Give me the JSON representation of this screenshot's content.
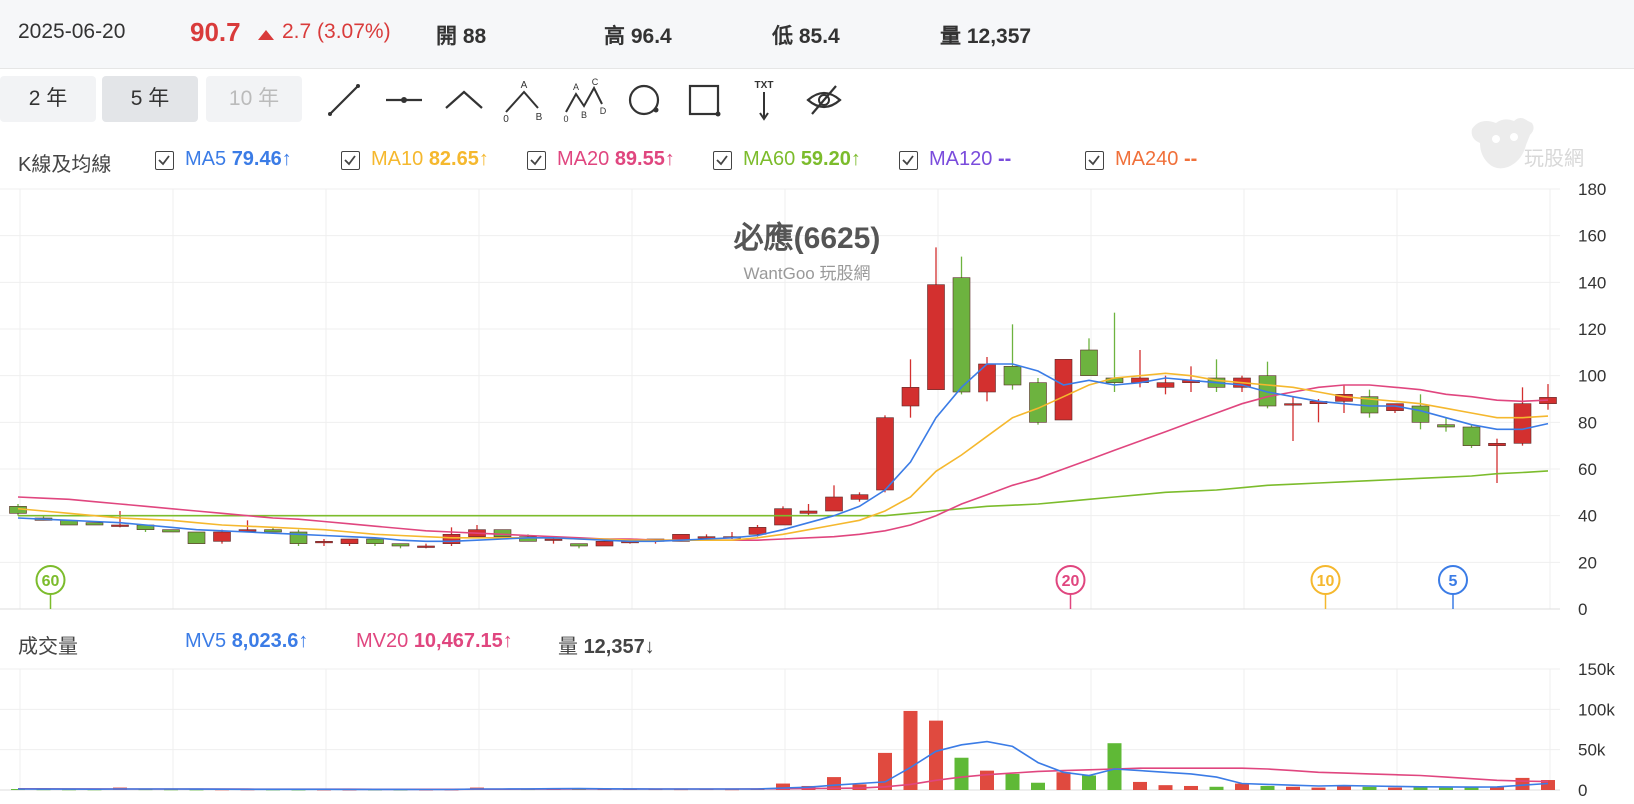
{
  "header": {
    "date": "2025-06-20",
    "price": "90.7",
    "change": "2.7 (3.07%)",
    "open": "開 88",
    "high": "高 96.4",
    "low": "低 85.4",
    "volume": "量 12,357"
  },
  "periods": [
    {
      "label": "2 年",
      "state": "normal"
    },
    {
      "label": "5 年",
      "state": "active"
    },
    {
      "label": "10 年",
      "state": "disabled"
    }
  ],
  "tools": [
    "line-icon",
    "horizontal-line-icon",
    "angle-line-icon",
    "abc-pattern-icon",
    "abcd-pattern-icon",
    "circle-icon",
    "rectangle-icon",
    "text-arrow-icon",
    "hide-eye-icon"
  ],
  "tool_labels": {
    "abc_a": "A",
    "abc_b": "B",
    "abc_o": "0",
    "abcd_a": "A",
    "abcd_b": "B",
    "abcd_c": "C",
    "abcd_d": "D",
    "abcd_o": "0",
    "txt": "TXT"
  },
  "kline_legend": {
    "title": "K線及均線",
    "items": [
      {
        "name": "MA5",
        "value": "79.46",
        "arrow": "↑",
        "color": "#3b7ce6"
      },
      {
        "name": "MA10",
        "value": "82.65",
        "arrow": "↑",
        "color": "#f5b82e"
      },
      {
        "name": "MA20",
        "value": "89.55",
        "arrow": "↑",
        "color": "#e0467f"
      },
      {
        "name": "MA60",
        "value": "59.20",
        "arrow": "↑",
        "color": "#7cbc2c"
      },
      {
        "name": "MA120",
        "value": "--",
        "arrow": "",
        "color": "#7a4cdc"
      },
      {
        "name": "MA240",
        "value": "--",
        "arrow": "",
        "color": "#f0703a"
      }
    ]
  },
  "volume_legend": {
    "title": "成交量",
    "items": [
      {
        "name": "MV5",
        "value": "8,023.6",
        "arrow": "↑",
        "color": "#3b7ce6"
      },
      {
        "name": "MV20",
        "value": "10,467.15",
        "arrow": "↑",
        "color": "#e0467f"
      },
      {
        "name": "量",
        "value": "12,357",
        "arrow": "↓",
        "color": "#444"
      }
    ]
  },
  "watermark": {
    "title": "必應(6625)",
    "subtitle": "WantGoo 玩股網",
    "logo_text": "玩股網"
  },
  "colors": {
    "up": "#d3302f",
    "down": "#6db33f",
    "ma5": "#3b7ce6",
    "ma10": "#f5b82e",
    "ma20": "#e0467f",
    "ma60": "#7cbc2c"
  },
  "chart_data": [
    {
      "type": "candlestick",
      "ylim": [
        0,
        180
      ],
      "yticks": [
        "0",
        "20",
        "40",
        "60",
        "80",
        "100",
        "120",
        "140",
        "160",
        "180"
      ],
      "ohlc": [
        [
          44,
          45,
          40,
          41
        ],
        [
          39,
          40,
          38,
          38
        ],
        [
          38,
          38,
          36,
          36
        ],
        [
          37,
          37,
          36,
          36
        ],
        [
          36,
          42,
          35,
          36
        ],
        [
          36,
          36,
          33,
          34
        ],
        [
          34,
          34,
          33,
          33
        ],
        [
          33,
          33,
          28,
          28
        ],
        [
          29,
          34,
          28,
          33
        ],
        [
          34,
          38,
          33,
          34
        ],
        [
          34,
          35,
          33,
          33
        ],
        [
          33,
          34,
          27,
          28
        ],
        [
          29,
          30,
          27,
          29
        ],
        [
          28,
          30,
          27,
          30
        ],
        [
          30,
          30,
          27,
          28
        ],
        [
          28,
          28,
          26,
          27
        ],
        [
          27,
          28,
          26,
          27
        ],
        [
          28,
          35,
          27,
          32
        ],
        [
          31,
          36,
          31,
          34
        ],
        [
          34,
          34,
          31,
          31
        ],
        [
          31,
          32,
          29,
          29
        ],
        [
          30,
          31,
          28,
          30
        ],
        [
          28,
          28,
          26,
          27
        ],
        [
          27,
          30,
          27,
          29
        ],
        [
          29,
          30,
          28,
          29
        ],
        [
          29,
          30,
          28,
          30
        ],
        [
          29,
          32,
          29,
          32
        ],
        [
          31,
          32,
          30,
          31
        ],
        [
          31,
          33,
          30,
          31
        ],
        [
          32,
          36,
          31,
          35
        ],
        [
          36,
          44,
          36,
          43
        ],
        [
          41,
          45,
          40,
          42
        ],
        [
          42,
          53,
          42,
          48
        ],
        [
          47,
          50,
          46,
          49
        ],
        [
          51,
          83,
          50,
          82
        ],
        [
          87,
          107,
          82,
          95
        ],
        [
          94,
          155,
          94,
          139
        ],
        [
          142,
          151,
          92,
          93
        ],
        [
          93,
          108,
          89,
          105
        ],
        [
          104,
          122,
          94,
          96
        ],
        [
          97,
          99,
          79,
          80
        ],
        [
          81,
          107,
          81,
          107
        ],
        [
          111,
          116,
          100,
          100
        ],
        [
          99,
          127,
          93,
          97
        ],
        [
          97,
          111,
          95,
          99
        ],
        [
          95,
          100,
          92,
          97
        ],
        [
          97,
          104,
          93,
          98
        ],
        [
          99,
          107,
          93,
          95
        ],
        [
          95,
          100,
          93,
          99
        ],
        [
          100,
          106,
          86,
          87
        ],
        [
          88,
          91,
          72,
          88
        ],
        [
          88,
          90,
          80,
          89
        ],
        [
          89,
          96,
          84,
          92
        ],
        [
          91,
          94,
          82,
          84
        ],
        [
          85,
          88,
          84,
          88
        ],
        [
          87,
          92,
          77,
          80
        ],
        [
          79,
          82,
          76,
          78
        ],
        [
          78,
          79,
          69,
          70
        ],
        [
          70,
          73,
          54,
          71
        ],
        [
          71,
          95,
          70,
          88
        ],
        [
          88,
          96.4,
          85.4,
          90.7
        ]
      ],
      "ma5": [
        39,
        38.5,
        38,
        37.5,
        37,
        36,
        35,
        34,
        33.5,
        33,
        32.5,
        32,
        31.5,
        31,
        30.5,
        29.5,
        29,
        29,
        29.5,
        30,
        30.5,
        30.5,
        30,
        29.5,
        29,
        29,
        29.5,
        30,
        30.5,
        31.5,
        34,
        37,
        40,
        44,
        51,
        63,
        82,
        95,
        105,
        105,
        102,
        96,
        98,
        96,
        97,
        99,
        98,
        97,
        96,
        93,
        91,
        89,
        88,
        87,
        87,
        85,
        82,
        79,
        77,
        77,
        79.46
      ],
      "ma10": [
        43,
        42,
        41,
        40,
        39,
        38.5,
        38,
        37,
        36,
        35.5,
        35,
        34.5,
        34,
        33,
        32,
        31.5,
        31,
        30.5,
        30.5,
        30.5,
        30.5,
        30.5,
        30,
        30,
        29.5,
        29.5,
        29.5,
        29.5,
        29.5,
        30.5,
        32,
        34,
        36,
        38,
        42,
        48,
        59,
        66,
        74,
        82,
        86,
        91,
        96,
        99,
        100,
        101,
        100,
        98,
        97,
        96,
        95,
        93,
        91,
        90,
        89,
        88,
        86,
        84,
        82,
        82,
        82.65
      ],
      "ma20": [
        48,
        47.5,
        47,
        46,
        45,
        44,
        43,
        42,
        41,
        40,
        39,
        38.5,
        37.5,
        36.5,
        35.5,
        34.5,
        33.5,
        33,
        32.5,
        32,
        31.5,
        31,
        30.5,
        30,
        30,
        29.5,
        29.5,
        29.5,
        29.5,
        29.5,
        30,
        30.5,
        31,
        32,
        33.5,
        36,
        40,
        45,
        49,
        53,
        56,
        60,
        64,
        68,
        72,
        76,
        80,
        84,
        88,
        91,
        93,
        95,
        96,
        96,
        95,
        94,
        92,
        91,
        89.5,
        89,
        89.55
      ],
      "ma60": [
        40,
        40,
        40,
        40,
        40,
        40,
        40,
        40,
        40,
        40,
        40,
        40,
        40,
        40,
        40,
        40,
        40,
        40,
        40,
        40,
        40,
        40,
        40,
        40,
        40,
        40,
        40,
        40,
        40,
        40,
        40,
        40,
        40,
        40,
        40,
        41,
        42,
        43,
        44,
        44.5,
        45,
        46,
        47,
        48,
        49,
        50,
        50.5,
        51,
        52,
        53,
        53.5,
        54,
        54.5,
        55,
        55.5,
        56,
        56.5,
        57,
        58,
        58.5,
        59.2
      ],
      "markers": [
        {
          "label": "60",
          "color": "#7cbc2c",
          "index": 1
        },
        {
          "label": "20",
          "color": "#e0467f",
          "index": 41
        },
        {
          "label": "10",
          "color": "#f5b82e",
          "index": 51
        },
        {
          "label": "5",
          "color": "#3b7ce6",
          "index": 56
        }
      ]
    },
    {
      "type": "bar",
      "ylim": [
        0,
        150000
      ],
      "yticks": [
        "0",
        "50k",
        "100k",
        "150k"
      ],
      "values": [
        1200,
        1000,
        900,
        900,
        3000,
        1100,
        900,
        800,
        900,
        900,
        800,
        700,
        700,
        600,
        700,
        600,
        600,
        700,
        3000,
        1500,
        1200,
        1800,
        1500,
        1200,
        1300,
        1200,
        1100,
        1200,
        1000,
        1800,
        8000,
        5000,
        16000,
        7000,
        46000,
        98000,
        86000,
        40000,
        24000,
        20000,
        9000,
        22000,
        18000,
        58000,
        10000,
        6000,
        5000,
        4000,
        8000,
        5000,
        4000,
        3000,
        6000,
        4000,
        3000,
        4000,
        3000,
        4000,
        4000,
        15000,
        12357
      ],
      "mv5": [
        1200,
        1150,
        1100,
        1050,
        1200,
        1300,
        1200,
        1100,
        1000,
        900,
        880,
        850,
        820,
        780,
        740,
        700,
        680,
        650,
        1200,
        1300,
        1400,
        1600,
        1700,
        1500,
        1400,
        1300,
        1250,
        1250,
        1200,
        1300,
        2500,
        3500,
        6000,
        8000,
        10000,
        28000,
        48000,
        56000,
        60000,
        54000,
        34000,
        22000,
        18000,
        26000,
        24000,
        22000,
        20000,
        16000,
        8000,
        7000,
        6000,
        5000,
        5500,
        5000,
        4500,
        4000,
        3800,
        3600,
        3800,
        6000,
        8023.6
      ],
      "mv20": [
        1500,
        1450,
        1400,
        1350,
        1300,
        1300,
        1250,
        1200,
        1150,
        1100,
        1050,
        1000,
        980,
        950,
        920,
        900,
        880,
        860,
        1000,
        1050,
        1100,
        1150,
        1200,
        1250,
        1300,
        1300,
        1300,
        1300,
        1300,
        1350,
        1600,
        1800,
        2100,
        2400,
        4000,
        7000,
        12000,
        16000,
        19000,
        21000,
        23000,
        24000,
        25000,
        26000,
        27000,
        27000,
        27000,
        27000,
        27000,
        26000,
        24000,
        22000,
        21000,
        20000,
        19000,
        18000,
        16000,
        14000,
        12000,
        11000,
        10467.15
      ]
    }
  ]
}
